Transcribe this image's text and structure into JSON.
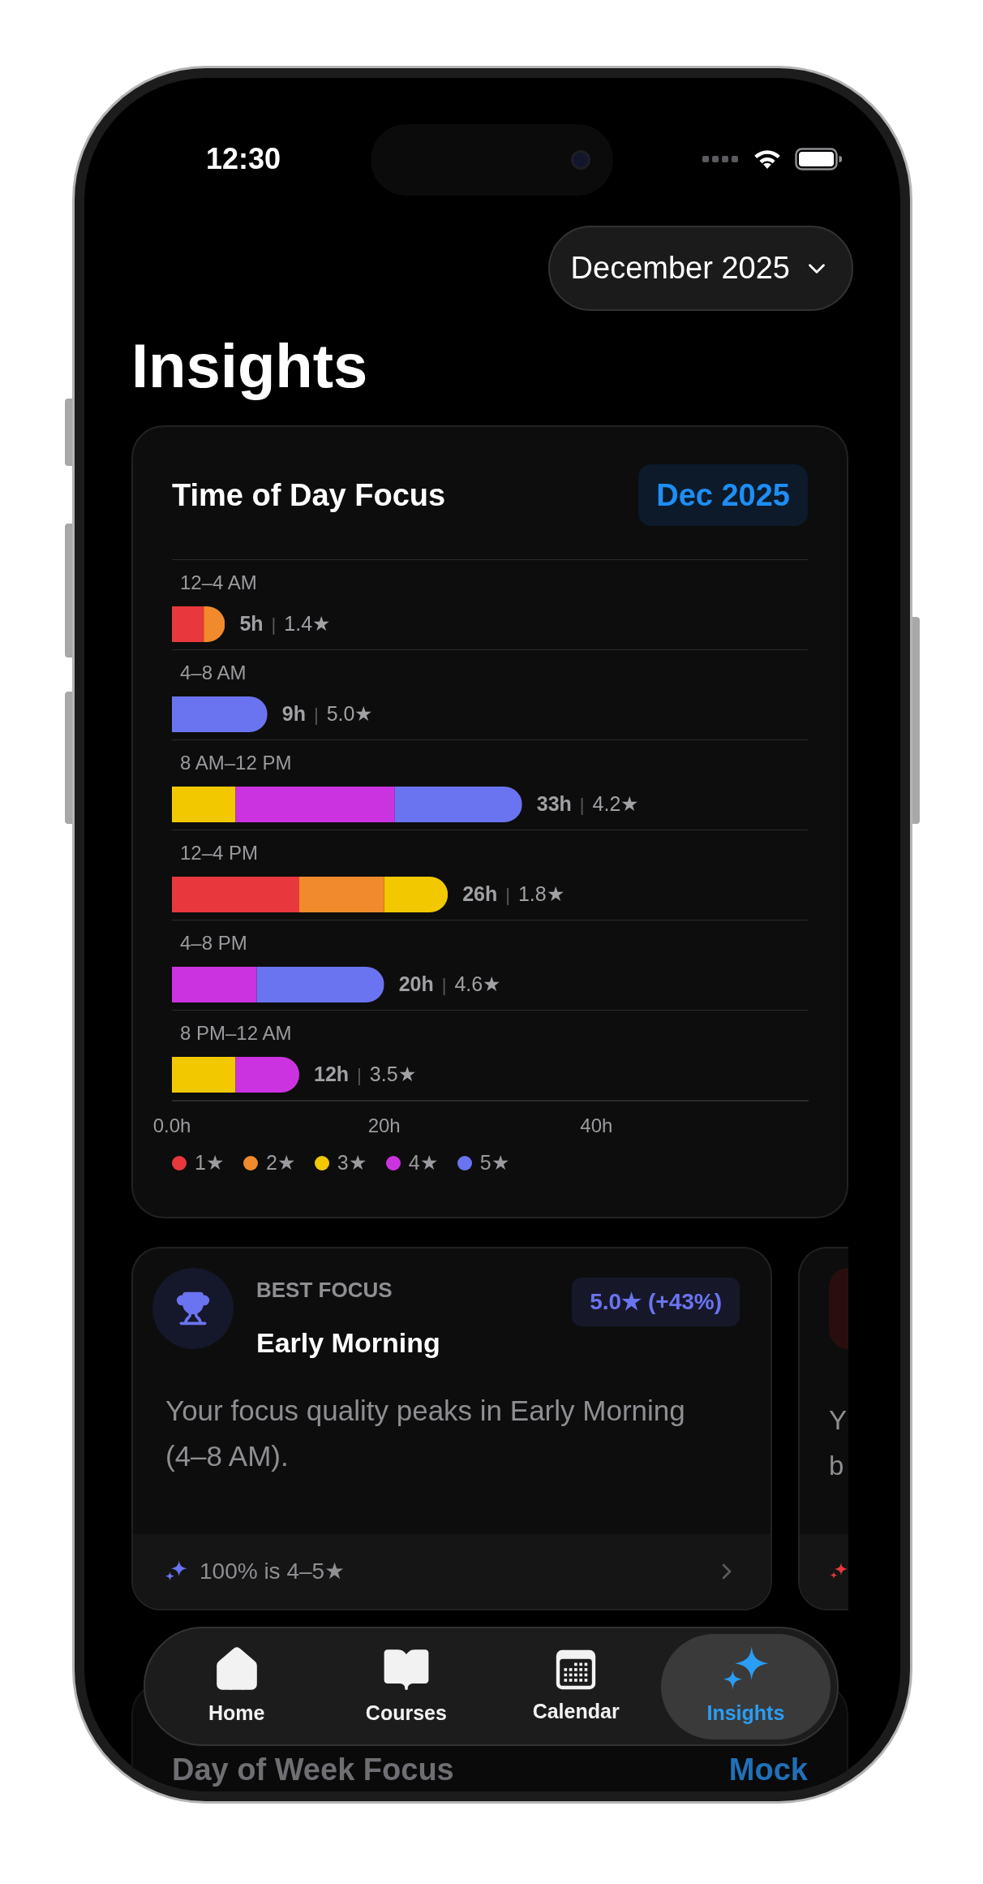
{
  "status_bar": {
    "time": "12:30"
  },
  "month_picker": {
    "label": "December 2025"
  },
  "title": "Insights",
  "time_of_day": {
    "title": "Time of Day Focus",
    "badge": "Dec 2025",
    "rows": [
      {
        "hours": "5h",
        "separator": "|",
        "rating": "1.4★"
      },
      {
        "hours": "9h",
        "separator": "|",
        "rating": "5.0★"
      },
      {
        "hours": "33h",
        "separator": "|",
        "rating": "4.2★"
      },
      {
        "hours": "26h",
        "separator": "|",
        "rating": "1.8★"
      },
      {
        "hours": "20h",
        "separator": "|",
        "rating": "4.6★"
      },
      {
        "hours": "12h",
        "separator": "|",
        "rating": "3.5★"
      }
    ],
    "chart_data": {
      "type": "bar",
      "orientation": "horizontal",
      "stacked": true,
      "categories": [
        "12–4 AM",
        "4–8 AM",
        "8 AM–12 PM",
        "12–4 PM",
        "4–8 PM",
        "8 PM–12 AM"
      ],
      "xlim": [
        0,
        60
      ],
      "legend": "bottom",
      "xticks": [
        {
          "value": 0,
          "label": "0.0h"
        },
        {
          "value": 20,
          "label": "20h"
        },
        {
          "value": 40,
          "label": "40h"
        }
      ],
      "series": [
        {
          "name": "1★",
          "color": "#e8383d",
          "values": [
            3,
            0,
            0,
            12,
            0,
            0
          ]
        },
        {
          "name": "2★",
          "color": "#f08a2c",
          "values": [
            2,
            0,
            0,
            8,
            0,
            0
          ]
        },
        {
          "name": "3★",
          "color": "#f2c800",
          "values": [
            0,
            0,
            6,
            6,
            0,
            6
          ]
        },
        {
          "name": "4★",
          "color": "#cc33e0",
          "values": [
            0,
            0,
            15,
            0,
            8,
            6
          ]
        },
        {
          "name": "5★",
          "color": "#6a74f0",
          "values": [
            0,
            9,
            12,
            0,
            12,
            0
          ]
        }
      ]
    }
  },
  "insight_cards": [
    {
      "kind": "full",
      "eyebrow": "BEST FOCUS",
      "title": "Early Morning",
      "badge": "5.0★ (+43%)",
      "description": "Your focus quality peaks in Early Morning (4–8 AM).",
      "footer": "100% is 4–5★",
      "color": "#6a74f0"
    },
    {
      "kind": "peek",
      "description_lines": [
        "Y",
        "b"
      ],
      "color": "#e8383d"
    }
  ],
  "next_section": {
    "title": "Day of Week Focus",
    "badge": "Mock"
  },
  "tab_bar": [
    {
      "label": "Home",
      "kind": "home",
      "selected": false
    },
    {
      "label": "Courses",
      "kind": "book",
      "selected": false
    },
    {
      "label": "Calendar",
      "kind": "calendar",
      "selected": false
    },
    {
      "label": "Insights",
      "kind": "sparkles",
      "selected": true
    }
  ]
}
